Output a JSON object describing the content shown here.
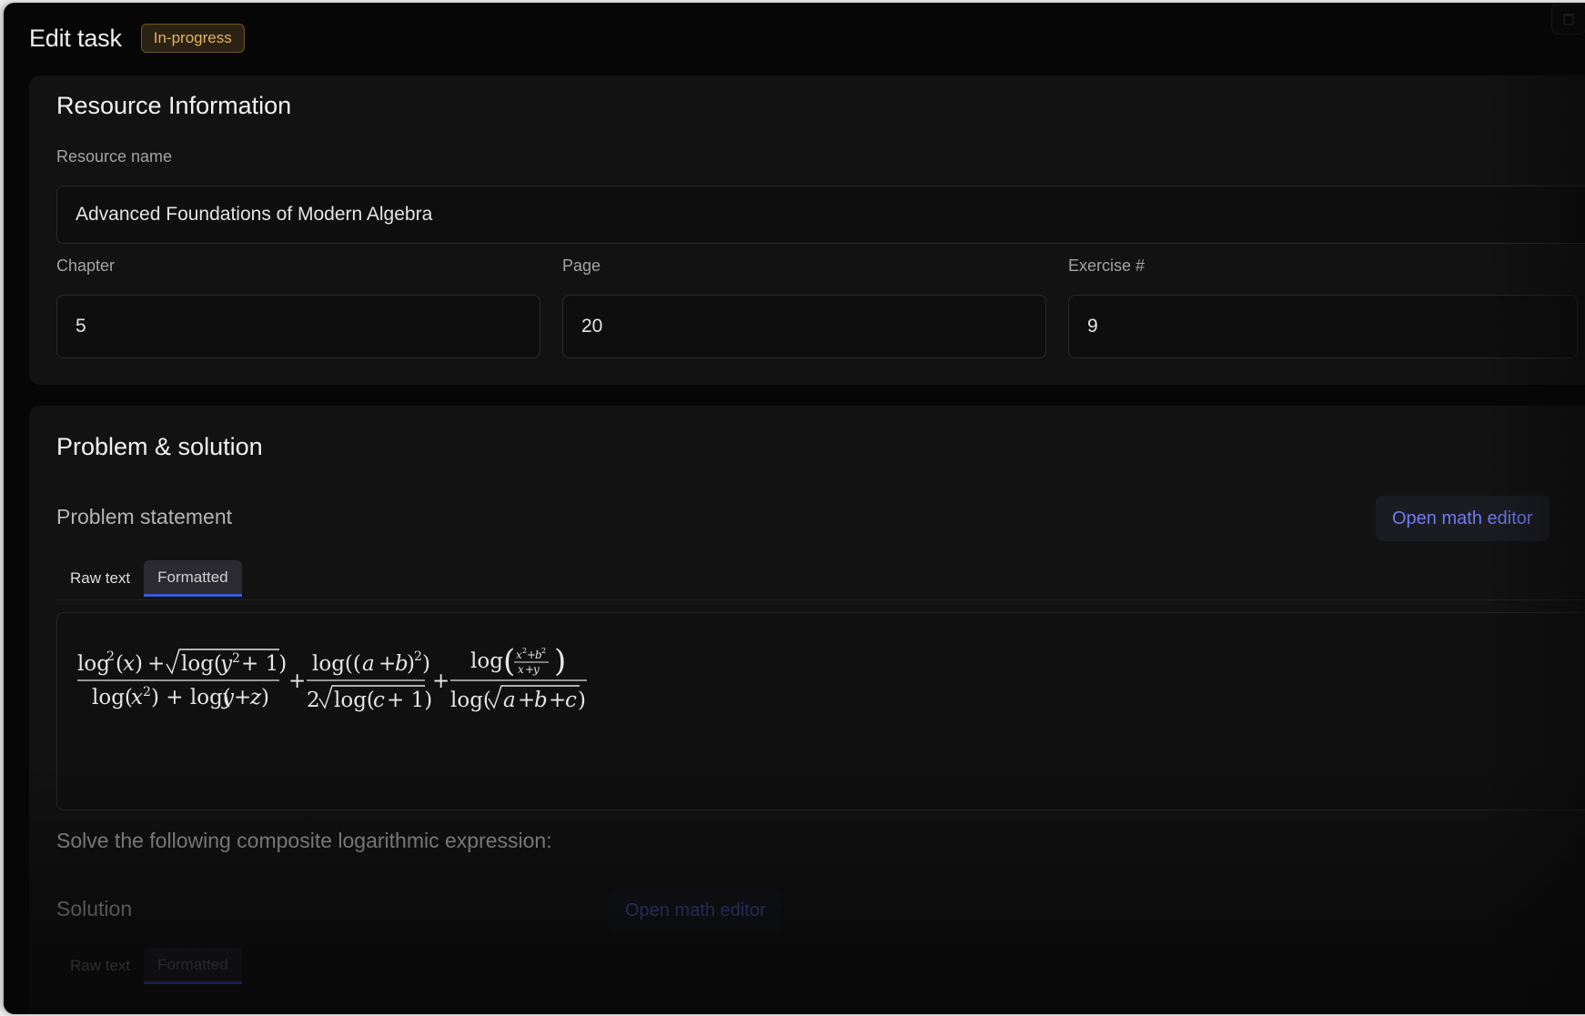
{
  "header": {
    "title": "Edit task",
    "status_badge": "In-progress"
  },
  "resource": {
    "section_title": "Resource Information",
    "name_label": "Resource name",
    "name_value": "Advanced Foundations of Modern Algebra",
    "chapter_label": "Chapter",
    "chapter_value": "5",
    "page_label": "Page",
    "page_value": "20",
    "exercise_label": "Exercise #",
    "exercise_value": "9"
  },
  "problem": {
    "section_title": "Problem & solution",
    "statement_label": "Problem statement",
    "math_editor_button": "Open math editor",
    "tabs": [
      {
        "label": "Raw text"
      },
      {
        "label": "Formatted"
      }
    ],
    "active_tab": "Formatted",
    "description": "Solve the following composite logarithmic expression:"
  },
  "solution": {
    "label": "Solution",
    "math_editor_button": "Open math editor",
    "tabs": [
      {
        "label": "Raw text"
      },
      {
        "label": "Formatted"
      }
    ],
    "active_tab": "Formatted"
  },
  "colors": {
    "background": "#060606",
    "card": "#121212",
    "badge_text": "#e2b45c",
    "accent_link": "#6d7cf0",
    "tab_underline": "#3a5bd8"
  }
}
